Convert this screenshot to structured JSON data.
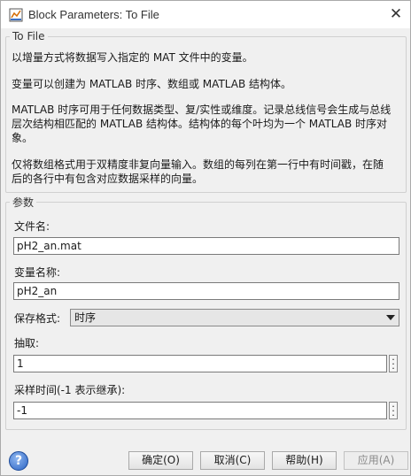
{
  "window": {
    "title": "Block Parameters: To File",
    "close_glyph": "✕"
  },
  "description": {
    "legend": "To File",
    "paragraphs": [
      "以增量方式将数据写入指定的 MAT 文件中的变量。",
      "变量可以创建为 MATLAB 时序、数组或 MATLAB 结构体。",
      "MATLAB 时序可用于任何数据类型、复/实性或维度。记录总线信号会生成与总线层次结构相匹配的 MATLAB 结构体。结构体的每个叶均为一个 MATLAB 时序对象。",
      "仅将数组格式用于双精度非复向量输入。数组的每列在第一行中有时间戳，在随后的各行中有包含对应数据采样的向量。"
    ]
  },
  "parameters": {
    "legend": "参数",
    "file_name_label": "文件名:",
    "file_name_value": "pH2_an.mat",
    "variable_name_label": "变量名称:",
    "variable_name_value": "pH2_an",
    "save_format_label": "保存格式:",
    "save_format_value": "时序",
    "decimation_label": "抽取:",
    "decimation_value": "1",
    "sample_time_label": "采样时间(-1 表示继承):",
    "sample_time_value": "-1"
  },
  "buttons": {
    "ok": "确定(O)",
    "cancel": "取消(C)",
    "help": "帮助(H)",
    "apply": "应用(A)"
  },
  "icons": {
    "app": "simulink-block-icon",
    "help": "help-icon",
    "help_glyph": "?"
  }
}
